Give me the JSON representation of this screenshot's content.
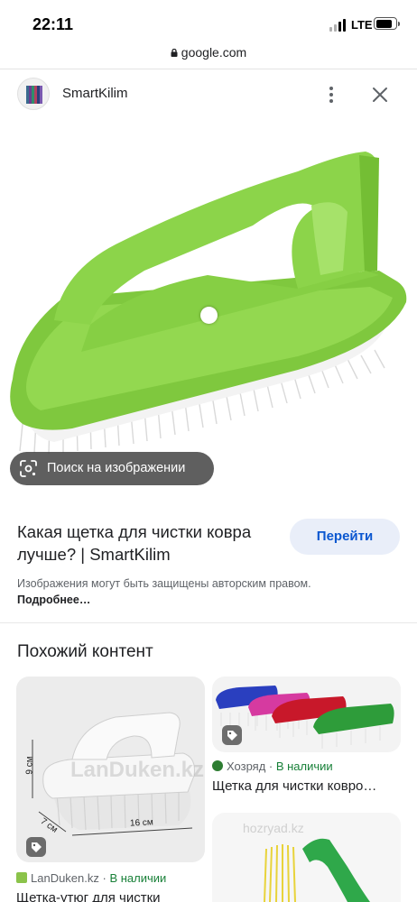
{
  "status_bar": {
    "time": "22:11",
    "network": "LTE",
    "battery_level": 0.85
  },
  "browser": {
    "url": "google.com"
  },
  "header": {
    "site_name": "SmartKilim",
    "more_icon": "more-vert-icon",
    "close_icon": "close-icon"
  },
  "hero": {
    "lens_label": "Поиск на изображении",
    "lens_icon": "lens-icon"
  },
  "result": {
    "title": "Какая щетка для чистки ковра лучше? | SmartKilim",
    "go_button": "Перейти",
    "notice": "Изображения могут быть защищены авторским правом.",
    "notice_link": "Подробнее…"
  },
  "related": {
    "heading": "Похожий контент",
    "cards": [
      {
        "source": "LanDuken.kz",
        "stock": "В наличии",
        "title": "Щетка-утюг для чистки",
        "dimensions": [
          "9 см",
          "7 см",
          "16 см"
        ],
        "watermark": "LanDuken.kz"
      },
      {
        "source": "Хозряд",
        "stock": "В наличии",
        "title": "Щетка для чистки ковро…"
      },
      {
        "watermark": "hozryad.kz"
      }
    ]
  },
  "colors": {
    "accent": "#0b57d0",
    "button_bg": "#e9eef9",
    "stock_green": "#188038",
    "brush_green": "#8cd44a"
  }
}
